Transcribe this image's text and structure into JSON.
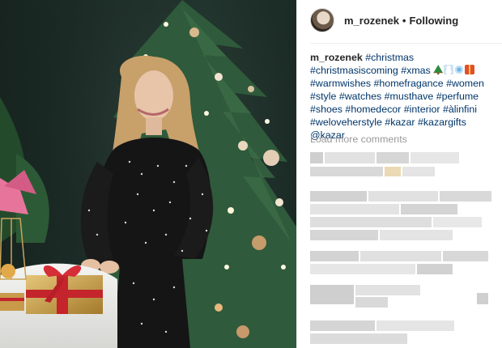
{
  "post": {
    "username": "m_rozenek",
    "separator": "•",
    "follow_status": "Following",
    "caption": {
      "user": "m_rozenek",
      "hashtags": [
        "#christmas",
        "#christmasiscoming",
        "#xmas",
        "#warmwishes",
        "#homefragance",
        "#women",
        "#style",
        "#watches",
        "#musthave",
        "#perfume",
        "#shoes",
        "#homedecor",
        "#interior",
        "#àlinfini",
        "#weloveherstyle",
        "#kazar",
        "#kazargifts"
      ],
      "emojis": [
        "christmas-tree-emoji",
        "snowman-emoji",
        "snowflake-emoji",
        "gift-emoji"
      ],
      "mention": "@kazar"
    },
    "load_more_label": "Load more comments"
  },
  "colors": {
    "link": "#003569",
    "muted": "#999999",
    "text": "#262626"
  }
}
